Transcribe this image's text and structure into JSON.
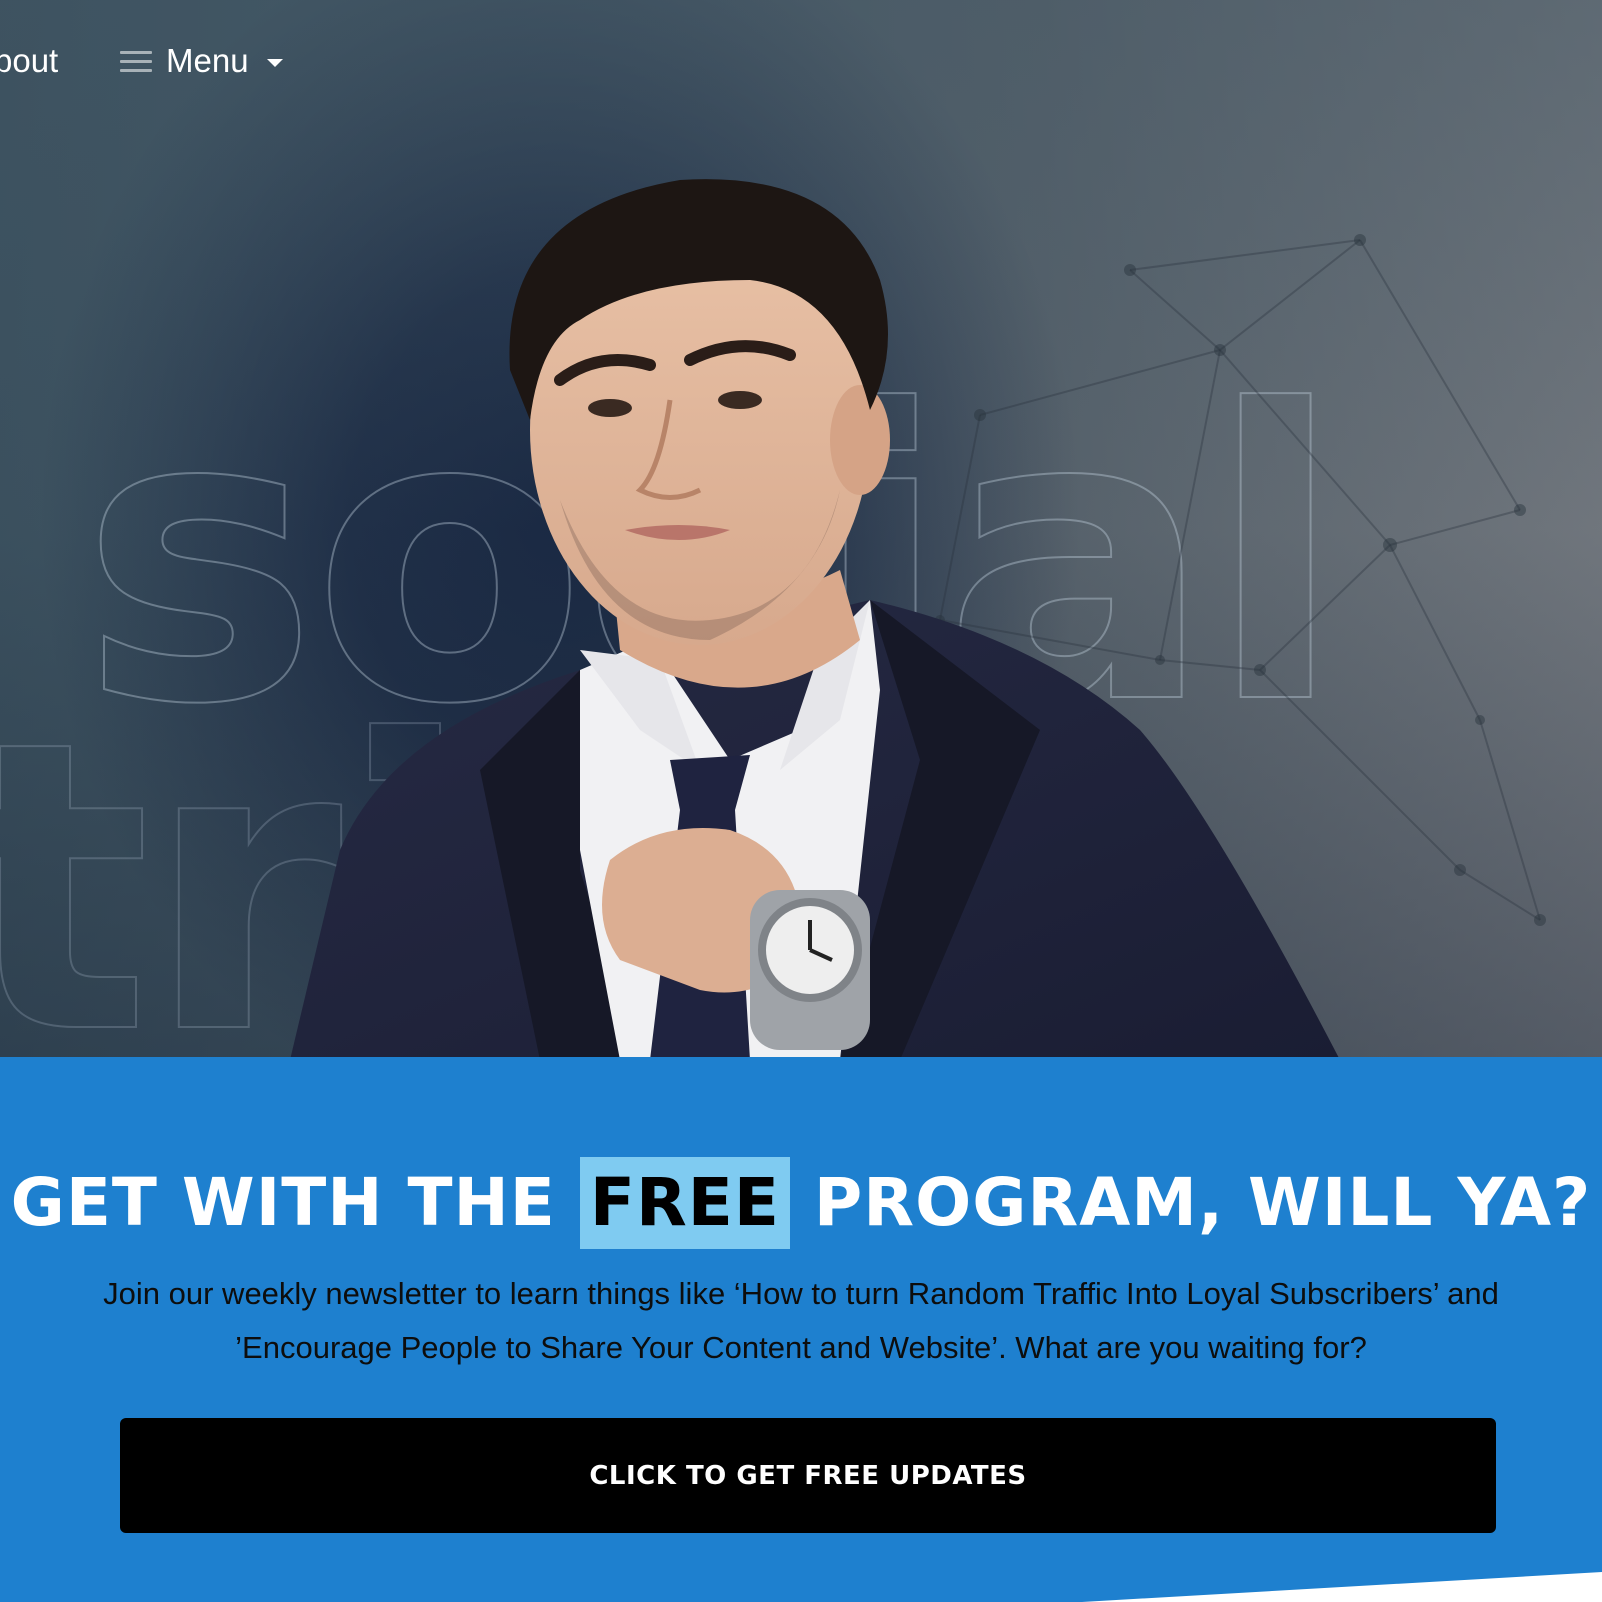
{
  "nav": {
    "about_label": "bout",
    "menu_label": "Menu",
    "menu_icon": "hamburger-icon",
    "caret_icon": "caret-down-icon"
  },
  "hero": {
    "background_word": "social",
    "background_word_lower": "triars",
    "colors": {
      "dark_navy": "#1b2a44",
      "slate": "#4b5f6b",
      "gray": "#7a7f84"
    }
  },
  "cta": {
    "headline_before": "GET WITH THE",
    "headline_highlight": "FREE",
    "headline_after": "PROGRAM, WILL YA?",
    "subtext_line1": "Join our weekly newsletter to learn things like ‘How to turn Random Traffic Into Loyal Subscribers’ and",
    "subtext_line2": "’Encourage People to Share Your Content and Website’. What are you waiting for?",
    "button_label": "CLICK TO GET FREE UPDATES",
    "colors": {
      "background": "#1e80cf",
      "highlight": "#7fcbf1",
      "button": "#000000"
    }
  }
}
